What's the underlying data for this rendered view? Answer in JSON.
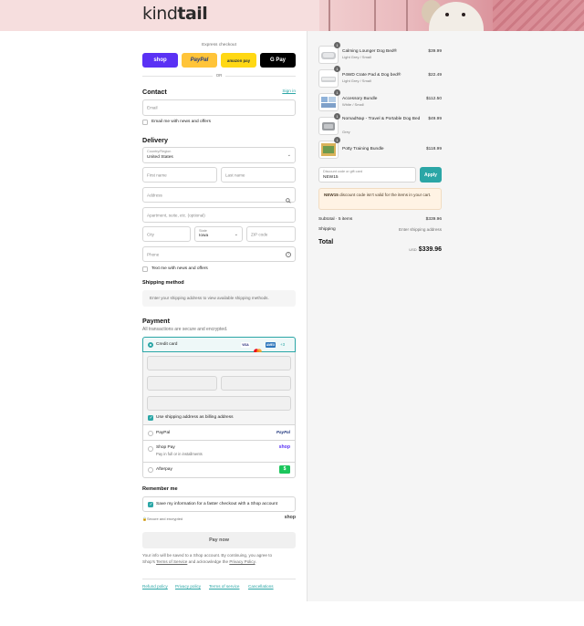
{
  "brand": {
    "logo_part1": "kind",
    "logo_part2": "tail"
  },
  "express": {
    "heading": "Express checkout",
    "shop_pay": "shop",
    "paypal": "PayPal",
    "amazon_pay": "amazon pay",
    "google_pay": "G Pay",
    "or": "OR"
  },
  "contact": {
    "heading": "Contact",
    "sign_in": "Sign in",
    "email_placeholder": "Email",
    "email_news": "Email me with news and offers"
  },
  "delivery": {
    "heading": "Delivery",
    "country_label": "Country/Region",
    "country_value": "United States",
    "first_name": "First name",
    "last_name": "Last name",
    "address": "Address",
    "apartment": "Apartment, suite, etc. (optional)",
    "city": "City",
    "state_label": "State",
    "state_value": "Iowa",
    "zip": "ZIP code",
    "phone": "Phone",
    "text_news": "Text me with news and offers"
  },
  "shipping_method": {
    "heading": "Shipping method",
    "note": "Enter your shipping address to view available shipping methods."
  },
  "payment": {
    "heading": "Payment",
    "subtitle": "All transactions are secure and encrypted.",
    "credit_card": "Credit card",
    "card_more": "+3",
    "billing_same": "Use shipping address as billing address",
    "paypal": "PayPal",
    "paypal_logo": "PayPal",
    "shop_pay": "Shop Pay",
    "shop_pay_sub": "Pay in full or in installments",
    "shop_logo": "shop",
    "afterpay": "Afterpay",
    "card_logos": [
      "VISA",
      "MC",
      "AMEX"
    ]
  },
  "remember": {
    "heading": "Remember me",
    "save_info": "Save my information for a faster checkout with a Shop account",
    "secure": "Secure and encrypted",
    "shop_logo": "shop"
  },
  "pay_now": "Pay now",
  "legal": {
    "line1": "Your info will be saved to a Shop account. By continuing, you agree to",
    "line2_pre": "Shop's ",
    "terms": "Terms of Service",
    "line2_mid": " and acknowledge the ",
    "privacy": "Privacy Policy",
    "line2_post": "."
  },
  "footer_links": [
    "Refund policy",
    "Privacy policy",
    "Terms of service",
    "Cancellations"
  ],
  "order": {
    "items": [
      {
        "qty": "1",
        "name": "Calming Lounger Dog Bed®",
        "variant": "Light Grey / Small",
        "price": "$39.99"
      },
      {
        "qty": "1",
        "name": "P4WD Crate Pad & Dog bed®",
        "variant": "Light Grey / Small",
        "price": "$22.49"
      },
      {
        "qty": "1",
        "name": "Accessory Bundle",
        "variant": "White / Small",
        "price": "$112.50"
      },
      {
        "qty": "1",
        "name": "NomadNap - Travel & Portable Dog Bed",
        "variant": "Grey",
        "price": "$49.99"
      },
      {
        "qty": "1",
        "name": "Potty Training Bundle",
        "variant": "",
        "price": "$118.99"
      }
    ],
    "discount_label": "Discount code or gift card",
    "discount_value": "NEW15",
    "apply": "Apply",
    "discount_error_code": "NEW15",
    "discount_error_text": " discount code isn't valid for the items in your cart.",
    "subtotal_label": "Subtotal · 5 items",
    "subtotal_value": "$339.96",
    "shipping_label": "Shipping",
    "shipping_value": "Enter shipping address",
    "total_label": "Total",
    "currency": "USD",
    "total_value": "$339.96"
  },
  "colors": {
    "accent": "#2ba6a6",
    "shop_purple": "#5a31f4",
    "paypal_yellow": "#ffc439",
    "header_pink": "#f6dede"
  }
}
